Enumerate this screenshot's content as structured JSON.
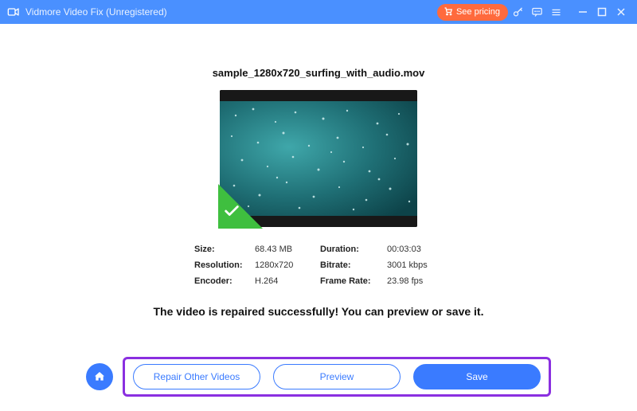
{
  "titlebar": {
    "app_title": "Vidmore Video Fix (Unregistered)",
    "pricing_label": "See pricing"
  },
  "file": {
    "name": "sample_1280x720_surfing_with_audio.mov"
  },
  "info": {
    "size_label": "Size:",
    "size_value": "68.43 MB",
    "duration_label": "Duration:",
    "duration_value": "00:03:03",
    "resolution_label": "Resolution:",
    "resolution_value": "1280x720",
    "bitrate_label": "Bitrate:",
    "bitrate_value": "3001 kbps",
    "encoder_label": "Encoder:",
    "encoder_value": "H.264",
    "framerate_label": "Frame Rate:",
    "framerate_value": "23.98 fps"
  },
  "message": "The video is repaired successfully! You can preview or save it.",
  "buttons": {
    "repair_other": "Repair Other Videos",
    "preview": "Preview",
    "save": "Save"
  }
}
